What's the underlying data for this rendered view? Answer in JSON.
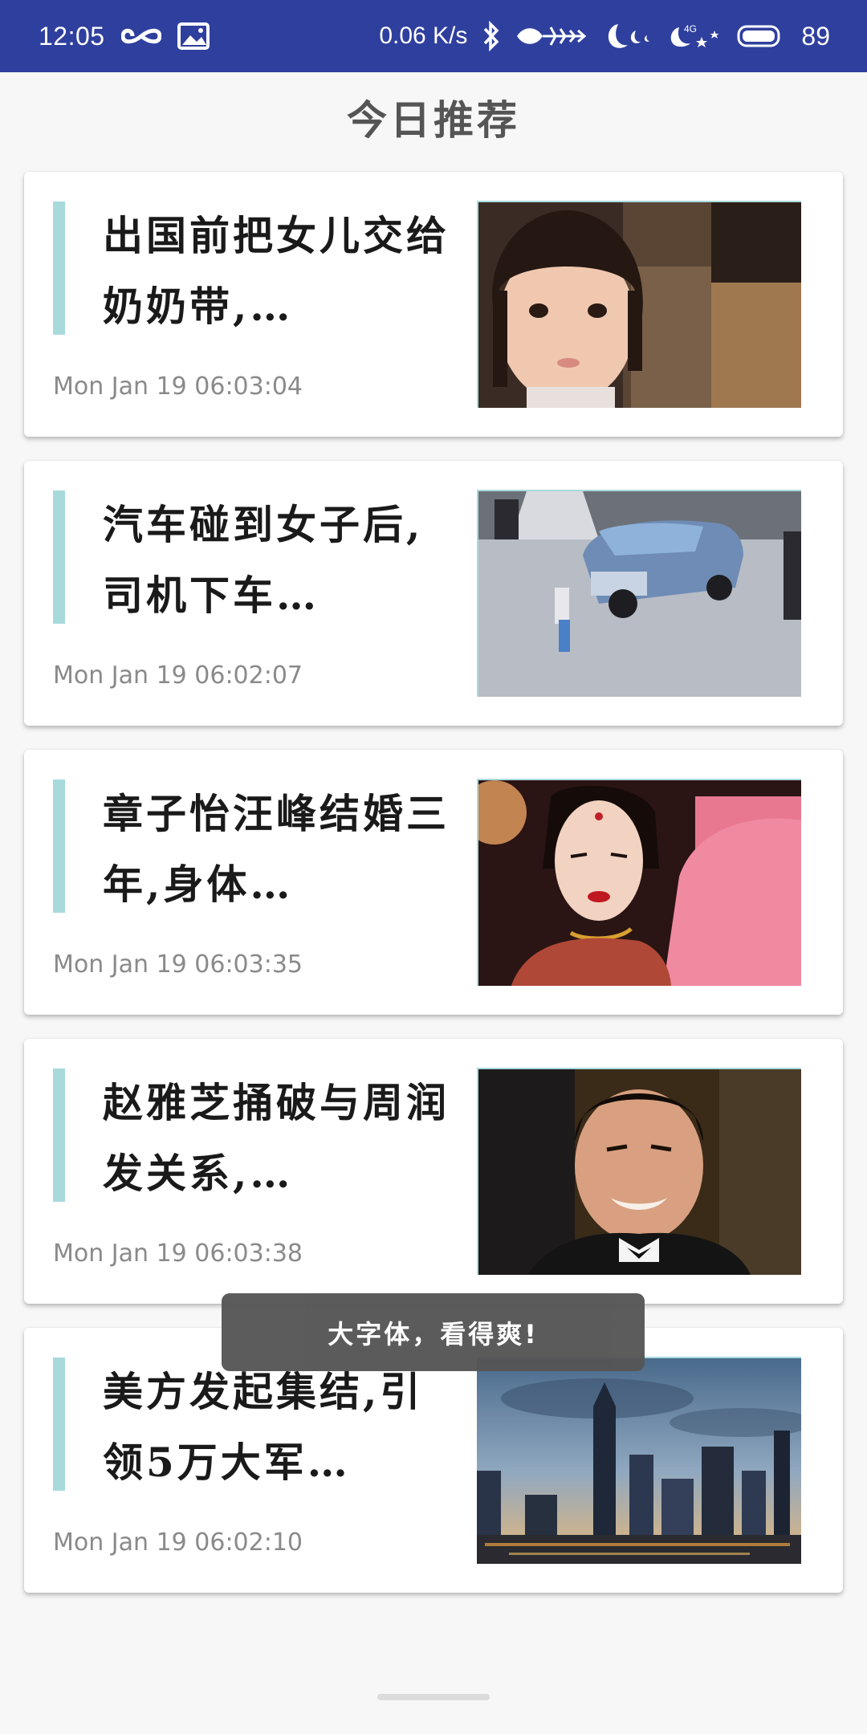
{
  "status_bar": {
    "time": "12:05",
    "net_speed": "0.06 K/s",
    "battery": "89",
    "icons": [
      "infinity-icon",
      "image-icon",
      "bluetooth-icon",
      "fishbone-icon",
      "moon-icon",
      "signal-4g-icon",
      "battery-icon"
    ],
    "bg_color": "#2f3f9e"
  },
  "header": {
    "title": "今日推荐"
  },
  "articles": [
    {
      "title": "出国前把女儿交给奶奶带,…",
      "time": "Mon Jan 19 06:03:04",
      "thumb": "girl-portrait-image"
    },
    {
      "title": "汽车碰到女子后,司机下车…",
      "time": "Mon Jan 19 06:02:07",
      "thumb": "car-street-image"
    },
    {
      "title": "章子怡汪峰结婚三年,身体…",
      "time": "Mon Jan 19 06:03:35",
      "thumb": "actress-image"
    },
    {
      "title": "赵雅芝捅破与周润发关系,…",
      "time": "Mon Jan 19 06:03:38",
      "thumb": "actor-smiling-image"
    },
    {
      "title": "美方发起集结,引领5万大军…",
      "time": "Mon Jan 19 06:02:10",
      "thumb": "city-skyline-image"
    }
  ],
  "toast": {
    "text": "大字体，看得爽!"
  },
  "colors": {
    "accent": "#a8dadc",
    "title_text": "#1a1a1a",
    "time_text": "#8a8a8a",
    "toast_bg": "#555555"
  }
}
